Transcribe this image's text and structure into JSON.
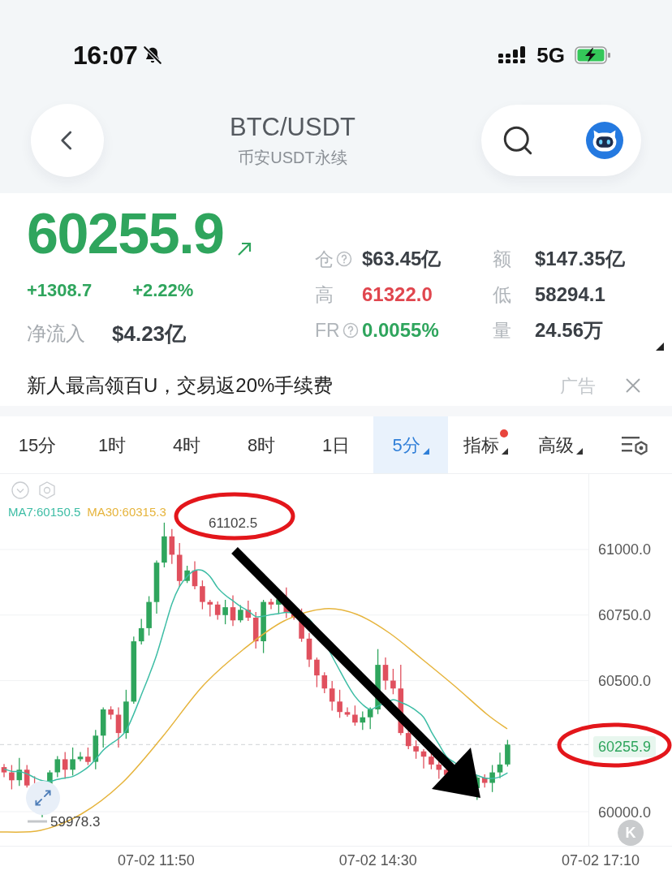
{
  "status_bar": {
    "time": "16:07",
    "network": "5G"
  },
  "header": {
    "title": "BTC/USDT",
    "subtitle": "币安USDT永续"
  },
  "ticker": {
    "price": "60255.9",
    "change": "+1308.7",
    "change_percent": "+2.22%",
    "net_inflow_label": "净流入",
    "net_inflow": "$4.23亿"
  },
  "stats": [
    {
      "label": "仓",
      "help": true,
      "value": "$63.45亿",
      "color": "#3a3f45"
    },
    {
      "label": "额",
      "help": false,
      "value": "$147.35亿",
      "color": "#3a3f45"
    },
    {
      "label": "高",
      "help": false,
      "value": "61322.0",
      "color": "#e0464e"
    },
    {
      "label": "低",
      "help": false,
      "value": "58294.1",
      "color": "#3a3f45"
    },
    {
      "label": "FR",
      "help": true,
      "value": "0.0055%",
      "color": "#2fa55d"
    },
    {
      "label": "量",
      "help": false,
      "value": "24.56万",
      "color": "#3a3f45"
    }
  ],
  "ad": {
    "text": "新人最高领百U，交易返20%手续费",
    "tag": "广告"
  },
  "tabs": [
    {
      "label": "15分",
      "selected": false,
      "dropdown": false,
      "dot": false
    },
    {
      "label": "1时",
      "selected": false,
      "dropdown": false,
      "dot": false
    },
    {
      "label": "4时",
      "selected": false,
      "dropdown": false,
      "dot": false
    },
    {
      "label": "8时",
      "selected": false,
      "dropdown": false,
      "dot": false
    },
    {
      "label": "1日",
      "selected": false,
      "dropdown": false,
      "dot": false
    },
    {
      "label": "5分",
      "selected": true,
      "dropdown": true,
      "dot": false
    },
    {
      "label": "指标",
      "selected": false,
      "dropdown": true,
      "dot": true
    },
    {
      "label": "高级",
      "selected": false,
      "dropdown": true,
      "dot": false
    }
  ],
  "chart": {
    "moving_averages": [
      {
        "kind": "short",
        "label": "MA7:60150.5",
        "color": "#3dbda5"
      },
      {
        "kind": "long",
        "label": "MA30:60315.3",
        "color": "#e6b43c"
      }
    ],
    "high_label": "61102.5",
    "low_label": "59978.3",
    "y_axis": [
      {
        "label": "61000.0",
        "current": false
      },
      {
        "label": "60750.0",
        "current": false
      },
      {
        "label": "60500.0",
        "current": false
      },
      {
        "label": "60255.9",
        "current": true
      },
      {
        "label": "60000.0",
        "current": false
      }
    ],
    "x_axis": [
      "07-02 11:50",
      "07-02 14:30",
      "07-02 17:10"
    ],
    "corner_button": "K"
  },
  "markup": [
    {
      "kind": "ellipse"
    },
    {
      "kind": "ellipse"
    },
    {
      "kind": "arrow"
    }
  ]
}
